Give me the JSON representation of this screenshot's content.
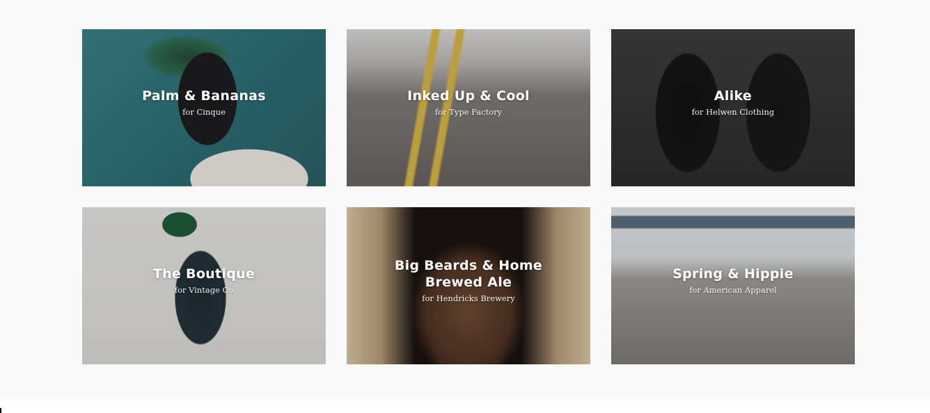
{
  "portfolio": {
    "items": [
      {
        "title": "Palm & Bananas",
        "client": "for Cinque"
      },
      {
        "title": "Inked Up & Cool",
        "client": "for Type Factory"
      },
      {
        "title": "Alike",
        "client": "for Helwen Clothing"
      },
      {
        "title": "The Boutique",
        "client": "for Vintage Co"
      },
      {
        "title": "Big Beards & Home Brewed Ale",
        "client": "for Hendricks Brewery"
      },
      {
        "title": "Spring & Hippie",
        "client": "for American Apparel"
      }
    ]
  },
  "colors": {
    "section_background": "#f9f9f9",
    "page_background": "#ffffff",
    "title_text": "#ffffff"
  }
}
